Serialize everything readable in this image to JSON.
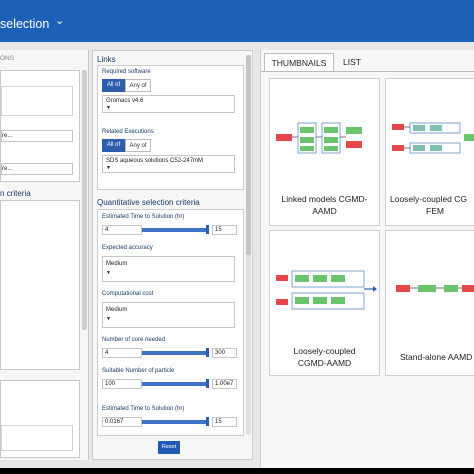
{
  "topbar": {
    "title": "selection",
    "chevron_icon": "chevron-down-icon"
  },
  "left_panel": {
    "header": "ONS",
    "field1": "re...",
    "field2": "re...",
    "criteria_label": "n criteria"
  },
  "middle_panel": {
    "links_title": "Links",
    "required_software": {
      "label": "Required software",
      "all_label": "All of",
      "any_label": "Any of",
      "value": "Gromacs v4.6"
    },
    "related_executions": {
      "label": "Related Executions",
      "all_label": "All of",
      "any_label": "Any of",
      "value": "SDS aqueous solutions C52-247mM"
    },
    "quant_title": "Quantitative selection criteria",
    "est_time_1": {
      "label": "Estimated Time to Solution (hr)",
      "min": "4",
      "max": "15"
    },
    "expected_accuracy": {
      "label": "Expected accuracy",
      "value": "Medium"
    },
    "computational_cost": {
      "label": "Computational cost",
      "value": "Medium"
    },
    "core_needed": {
      "label": "Number of core needed",
      "min": "4",
      "max": "300"
    },
    "particles": {
      "label": "Suitable Number of particle",
      "min": "100",
      "max": "1.00e7"
    },
    "est_time_2": {
      "label": "Estimated Time to Solution (hr)",
      "min": "0.0167",
      "max": "15"
    },
    "reset_label": "Reset"
  },
  "right_panel": {
    "tabs": [
      "THUMBNAILS",
      "LIST"
    ],
    "cards": [
      {
        "line1": "Linked models CGMD-",
        "line2": "AAMD"
      },
      {
        "line1": "Loosely-coupled CG",
        "line2": "FEM"
      },
      {
        "line1": "Loosely-coupled",
        "line2": "CGMD-AAMD"
      },
      {
        "line1": "Stand-alone AAMD",
        "line2": ""
      }
    ]
  },
  "colors": {
    "brand": "#1c60b8",
    "accent": "#2d5dac",
    "node_red": "#e4484b",
    "node_green": "#6bc36b",
    "node_teal": "#7fbfb1"
  }
}
